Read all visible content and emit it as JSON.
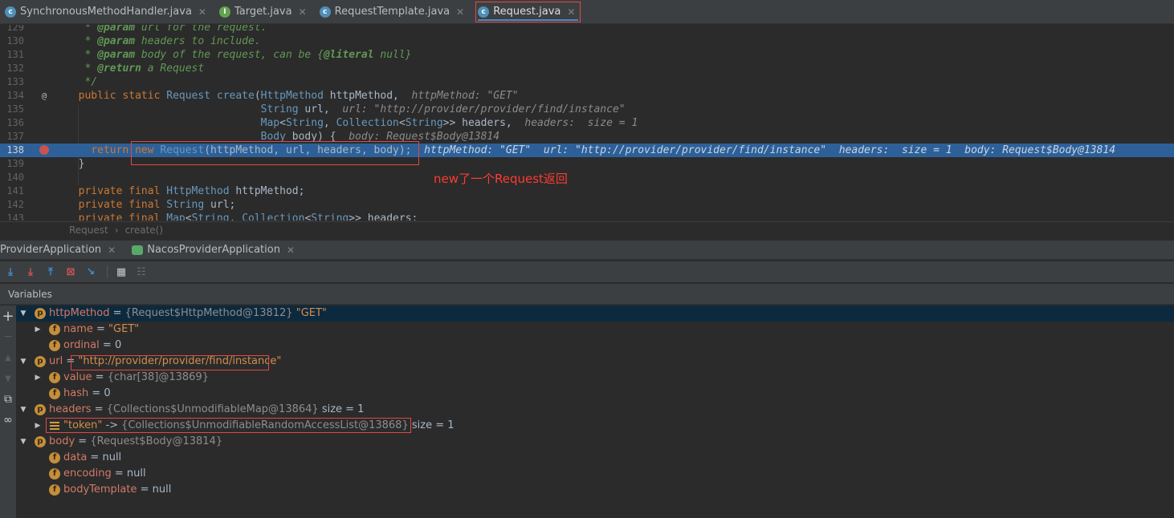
{
  "editor_tabs": [
    {
      "label": "SynchronousMethodHandler.java",
      "icon": "class-icon",
      "active": false
    },
    {
      "label": "Target.java",
      "icon": "interface-icon",
      "active": false
    },
    {
      "label": "RequestTemplate.java",
      "icon": "class-icon",
      "active": false
    },
    {
      "label": "Request.java",
      "icon": "class-icon",
      "active": true
    }
  ],
  "code_lines": [
    {
      "num": "129",
      "text": "   * @param url for the request."
    },
    {
      "num": "130",
      "text": "   * @param headers to include."
    },
    {
      "num": "131",
      "text": "   * @param body of the request, can be {@literal null}"
    },
    {
      "num": "132",
      "text": "   * @return a Request"
    },
    {
      "num": "133",
      "text": "   */"
    },
    {
      "num": "134",
      "text": "  public static Request create(HttpMethod httpMethod,",
      "hint": "httpMethod: \"GET\"",
      "gutter": "@"
    },
    {
      "num": "135",
      "text": "                               String url,",
      "hint": "url: \"http://provider/provider/find/instance\""
    },
    {
      "num": "136",
      "text": "                               Map<String, Collection<String>> headers,",
      "hint": "headers:  size = 1"
    },
    {
      "num": "137",
      "text": "                               Body body) {",
      "hint": "body: Request$Body@13814"
    },
    {
      "num": "138",
      "text": "    return new Request(httpMethod, url, headers, body);",
      "hint": "httpMethod: \"GET\"  url: \"http://provider/provider/find/instance\"  headers:  size = 1  body: Request$Body@13814",
      "breakpoint": true
    },
    {
      "num": "139",
      "text": "  }"
    },
    {
      "num": "140",
      "text": ""
    },
    {
      "num": "141",
      "text": "  private final HttpMethod httpMethod;"
    },
    {
      "num": "142",
      "text": "  private final String url;"
    },
    {
      "num": "143",
      "text": "  private final Map<String, Collection<String>> headers;"
    }
  ],
  "annotation": "new了一个Request返回",
  "breadcrumb": [
    "Request",
    "create()"
  ],
  "debug_tabs": [
    {
      "label": "ProviderApplication"
    },
    {
      "label": "NacosProviderApplication"
    }
  ],
  "variables_title": "Variables",
  "variables": [
    {
      "name": "httpMethod",
      "eq": " = ",
      "ref": "{Request$HttpMethod@13812} ",
      "value": "\"GET\"",
      "badge": "p",
      "level": 0,
      "expand": "open",
      "selected": true
    },
    {
      "name": "name",
      "eq": " = ",
      "ref": "",
      "value": "\"GET\"",
      "badge": "f",
      "level": 1,
      "expand": "closed",
      "valueKind": "str"
    },
    {
      "name": "ordinal",
      "eq": " = ",
      "ref": "",
      "value": "0",
      "badge": "f",
      "level": 1,
      "expand": "none"
    },
    {
      "name": "url",
      "eq": " = ",
      "ref": "",
      "value": "\"http://provider/provider/find/instance\"",
      "badge": "p",
      "level": 0,
      "expand": "open",
      "valueKind": "str"
    },
    {
      "name": "value",
      "eq": " = ",
      "ref": "{char[38]@13869}",
      "value": "",
      "badge": "f",
      "level": 1,
      "expand": "closed"
    },
    {
      "name": "hash",
      "eq": " = ",
      "ref": "",
      "value": "0",
      "badge": "f",
      "level": 1,
      "expand": "none"
    },
    {
      "name": "headers",
      "eq": " = ",
      "ref": "{Collections$UnmodifiableMap@13864}  ",
      "value": "size = 1",
      "badge": "p",
      "level": 0,
      "expand": "open"
    },
    {
      "name": "\"token\"",
      "eq": " -> ",
      "ref": "{Collections$UnmodifiableRandomAccessList@13868}  ",
      "value": "size = 1",
      "badge": "list",
      "level": 1,
      "expand": "closed",
      "nameKind": "str"
    },
    {
      "name": "body",
      "eq": " = ",
      "ref": "{Request$Body@13814}",
      "value": "",
      "badge": "p",
      "level": 0,
      "expand": "open"
    },
    {
      "name": "data",
      "eq": " = ",
      "ref": "",
      "value": "null",
      "badge": "f",
      "level": 1,
      "expand": "none"
    },
    {
      "name": "encoding",
      "eq": " = ",
      "ref": "",
      "value": "null",
      "badge": "f",
      "level": 1,
      "expand": "none"
    },
    {
      "name": "bodyTemplate",
      "eq": " = ",
      "ref": "",
      "value": "null",
      "badge": "f",
      "level": 1,
      "expand": "none"
    }
  ],
  "toolbar_icons": [
    "step-over-icon",
    "step-into-icon",
    "step-out-icon",
    "drop-frame-icon",
    "run-to-cursor-icon",
    "evaluate-icon",
    "trace-icon"
  ],
  "colors": {
    "highlight": "#2d6099",
    "annotation": "#ff3b30",
    "selected_row": "#0d293e"
  }
}
